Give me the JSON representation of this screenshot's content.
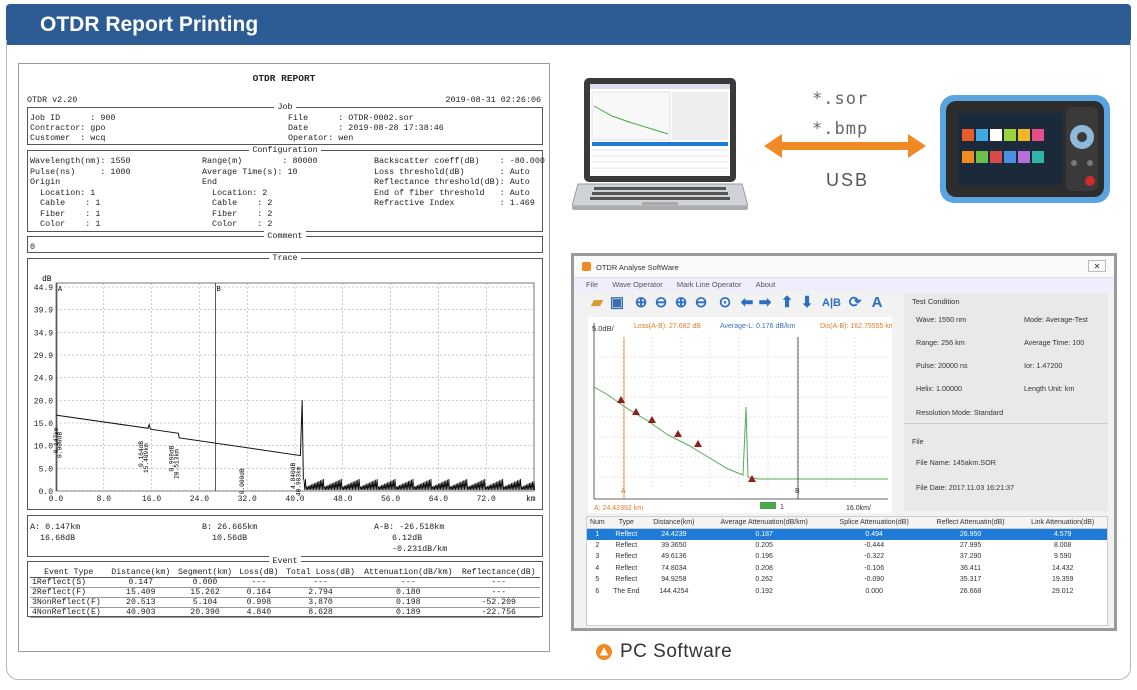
{
  "header": {
    "title": "OTDR Report Printing"
  },
  "report": {
    "title": "OTDR REPORT",
    "version": "OTDR v2.20",
    "datetime": "2019-08-31 02:26:06",
    "job": {
      "label": "Job",
      "job_id": "Job ID      : 900",
      "contractor": "Contractor: gpo",
      "customer": "Customer  : wcq",
      "file": "File      : OTDR-0002.sor",
      "date": "Date      : 2019-08-28 17:38:46",
      "operator": "Operator: wen"
    },
    "config": {
      "label": "Configuration",
      "col1": [
        "Wavelength(nm): 1550",
        "Pulse(ns)     : 1000",
        "Origin",
        "  Location: 1",
        "  Cable    : 1",
        "  Fiber    : 1",
        "  Color    : 1"
      ],
      "col2": [
        "Range(m)        : 80000",
        "Average Time(s): 10",
        "End",
        "  Location: 2",
        "  Cable    : 2",
        "  Fiber    : 2",
        "  Color    : 2"
      ],
      "col3": [
        "Backscatter coeff(dB)    : -80.000",
        "Loss threshold(dB)       : Auto",
        "Reflectance threshold(dB): Auto",
        "End of fiber threshold   : Auto",
        "Refractive Index         : 1.469"
      ]
    },
    "comment": {
      "label": "Comment",
      "value": "0"
    },
    "trace": {
      "label": "Trace",
      "y_unit": "dB",
      "x_unit": "km",
      "y_ticks": [
        "44.9",
        "39.9",
        "34.9",
        "29.9",
        "24.9",
        "20.0",
        "15.0",
        "10.0",
        "5.0",
        "0.0"
      ],
      "x_ticks": [
        "0.0",
        "8.0",
        "16.0",
        "24.0",
        "32.0",
        "40.0",
        "48.0",
        "56.0",
        "64.0",
        "72.0"
      ],
      "marker_a": "A",
      "marker_b": "B",
      "event_labels": [
        "0.147km",
        "0.000dB",
        "0.164dB",
        "15.409km",
        "0.998dB",
        "20.513km",
        "4.840dB",
        "40.903km",
        "0.000dB"
      ]
    },
    "ab": {
      "a": "A: 0.147km",
      "a_db": "16.68dB",
      "b": "B: 26.665km",
      "b_db": "10.56dB",
      "ab": "A-B: -26.518km",
      "ab_db": "6.12dB",
      "ab_att": "-0.231dB/km"
    },
    "events": {
      "label": "Event",
      "headers": [
        "Event Type",
        "Distance(km)",
        "Segment(km)",
        "Loss(dB)",
        "Total Loss(dB)",
        "Attenuation(dB/km)",
        "Reflectance(dB)"
      ],
      "rows": [
        [
          "1Reflect(S)",
          "0.147",
          "0.000",
          "---",
          "---",
          "---",
          "---"
        ],
        [
          "2Reflect(F)",
          "15.409",
          "15.262",
          "0.164",
          "2.794",
          "0.180",
          "---"
        ],
        [
          "3NonReflect(F)",
          "20.513",
          "5.104",
          "0.998",
          "3.870",
          "0.198",
          "-52.209"
        ],
        [
          "4NonReflect(E)",
          "40.903",
          "20.390",
          "4.840",
          "8.628",
          "0.189",
          "-22.756"
        ]
      ]
    }
  },
  "transfer": {
    "file1": "*.sor",
    "file2": "*.bmp",
    "usb": "USB"
  },
  "software": {
    "title": "OTDR Analyse SoftWare",
    "menu": [
      "File",
      "Wave Operator",
      "Mark Line Operator",
      "About"
    ],
    "graph": {
      "y_unit": "5.0dB/",
      "loss": "Loss(A-B): 27.682 dB",
      "avg": "Average-L: 0.176 dB/km",
      "dis": "Dis(A-B): 162.75555 km",
      "a_label": "A: 24.42392 km",
      "x_unit": "16.0km/",
      "marker_a": "A",
      "marker_b": "B",
      "trace_idx": "1"
    },
    "test": {
      "title": "Test Condition",
      "wave": "Wave:      1550 nm",
      "mode": "Mode:    Average-Test",
      "range": "Range:     256 km",
      "avg_time": "Average Time:  100",
      "pulse": "Pulse:      20000 ns",
      "ior": "Ior:       1.47200",
      "helix": "Helix:      1.00000",
      "length_unit": "Length Unit:   km",
      "resolution": "Resolution Mode:   Standard",
      "file_title": "File",
      "file_name": "File Name:   145akm.SOR",
      "file_date": "File Date:    2017.11.03  16:21:37"
    },
    "table": {
      "headers": [
        "Num",
        "Type",
        "Distance(km)",
        "Average Attenuation(dB/km)",
        "Splice Attenuation(dB)",
        "Reflect Attenuatin(dB)",
        "Link Attenuation(dB)"
      ],
      "rows": [
        [
          "1",
          "Reflect",
          "24.4239",
          "0.187",
          "0.494",
          "26.950",
          "4.579"
        ],
        [
          "2",
          "Reflect",
          "39.3650",
          "0.205",
          "-0.444",
          "27.995",
          "8.008"
        ],
        [
          "3",
          "Reflect",
          "49.6136",
          "0.196",
          "-0.322",
          "37.290",
          "9.590"
        ],
        [
          "4",
          "Reflect",
          "74.8034",
          "0.208",
          "-0.106",
          "36.411",
          "14.432"
        ],
        [
          "5",
          "Reflect",
          "94.9258",
          "0.262",
          "-0.090",
          "35.317",
          "19.359"
        ],
        [
          "6",
          "The End",
          "144.4254",
          "0.192",
          "0.000",
          "26.668",
          "29.012"
        ]
      ]
    }
  },
  "footer": {
    "pc_label": "PC Software"
  },
  "colors": {
    "header_bg": "#2c5c93",
    "accent_orange": "#f08a24",
    "selected_row": "#1e7bd8",
    "trace_green": "#4aa84a"
  }
}
